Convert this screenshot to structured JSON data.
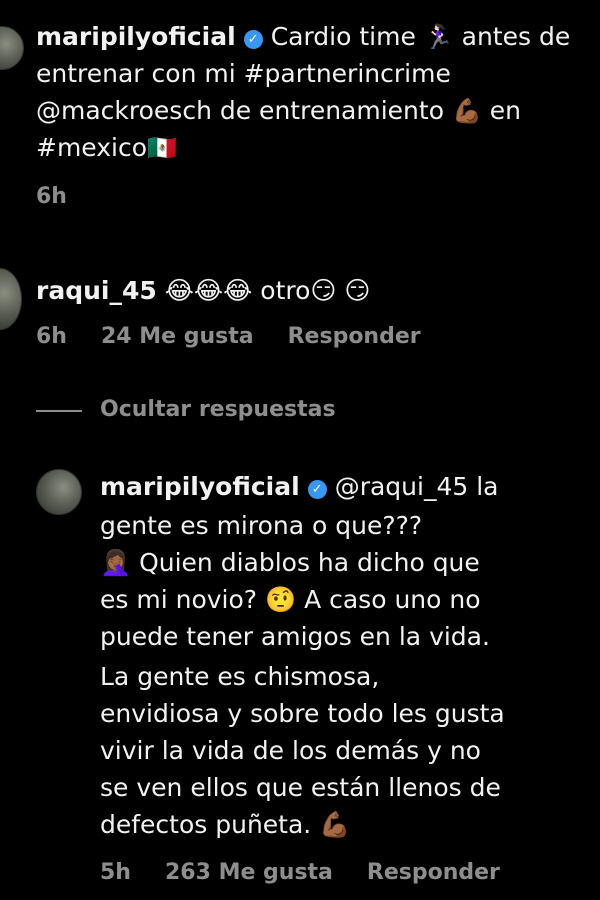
{
  "post": {
    "username": "maripilyoficial",
    "line1_text": "Cardio time ",
    "line1_emoji": "🏃🏻‍♀️",
    "line1_tail": " antes de",
    "line2": "entrenar con mi #partnerincrime",
    "line3_text": "@mackroesch de entrenamiento ",
    "line3_emoji": "💪🏾",
    "line3_tail": " en",
    "line4_text": "#mexico",
    "line4_emoji": "🇲🇽",
    "time": "6h"
  },
  "comment": {
    "username": "raqui_45",
    "text": " 😂😂😂 otro😏 😏",
    "time": "6h",
    "likes": "24 Me gusta",
    "reply": "Responder"
  },
  "hide_replies": "Ocultar respuestas",
  "reply": {
    "username": "maripilyoficial",
    "lines": [
      "@raqui_45 la",
      "gente es mirona o que???",
      "🤦🏾‍♀️ Quien diablos ha dicho que",
      "es mi novio? 🤨  A caso uno no",
      "puede tener amigos en la vida.",
      "La gente es chismosa,",
      "envidiosa y sobre todo les gusta",
      "vivir la vida de los demás y no",
      "se ven ellos que están llenos de",
      "defectos puñeta. 💪🏾"
    ],
    "time": "5h",
    "likes": "263 Me gusta",
    "reply": "Responder"
  },
  "verified_mark": "✓"
}
